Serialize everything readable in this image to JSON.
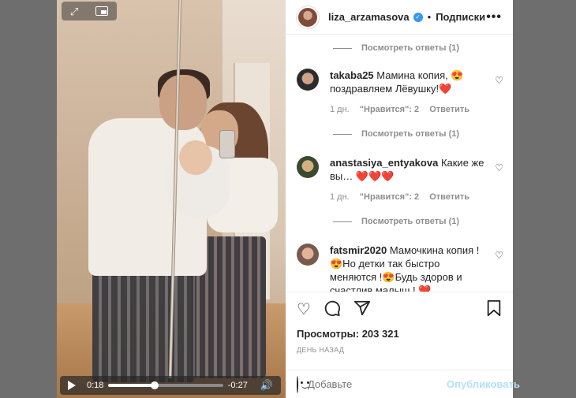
{
  "video": {
    "current_time": "0:18",
    "remaining_time": "-0:27",
    "progress": 0.4,
    "icons": [
      "expand-icon",
      "pip-icon",
      "play-icon",
      "volume-icon"
    ]
  },
  "header": {
    "username": "liza_arzamasova",
    "separator": "•",
    "follow_label": "Подписки",
    "more_label": "•••"
  },
  "comments": [
    {
      "type": "replies",
      "label": "Посмотреть ответы (1)"
    },
    {
      "type": "comment",
      "author": "takaba25",
      "text": "Мамина копия, 😍 поздравляем Лёвушку!❤️",
      "time": "1 дн.",
      "likes": "\"Нравится\": 2",
      "reply": "Ответить"
    },
    {
      "type": "replies",
      "label": "Посмотреть ответы (1)"
    },
    {
      "type": "comment",
      "author": "anastasiya_entyakova",
      "text": "Какие же вы… ❤️❤️❤️",
      "time": "1 дн.",
      "likes": "\"Нравится\": 2",
      "reply": "Ответить"
    },
    {
      "type": "replies",
      "label": "Посмотреть ответы (1)"
    },
    {
      "type": "comment",
      "author": "fatsmir2020",
      "text": "Мамочкина копия ! 😍Но детки так быстро меняются !😍Будь здоров и счастлив малыш ! ❤️"
    }
  ],
  "actions": {
    "views": "Просмотры: 203 321",
    "posted": "ДЕНЬ НАЗАД"
  },
  "add_comment": {
    "placeholder": "Добавьте",
    "publish_label": "Опубликовать"
  },
  "colors": {
    "link_blue": "#3897f0",
    "publish_disabled": "#b2dffc",
    "heart_red": "#ed4956",
    "meta_gray": "#8e8e8e"
  }
}
